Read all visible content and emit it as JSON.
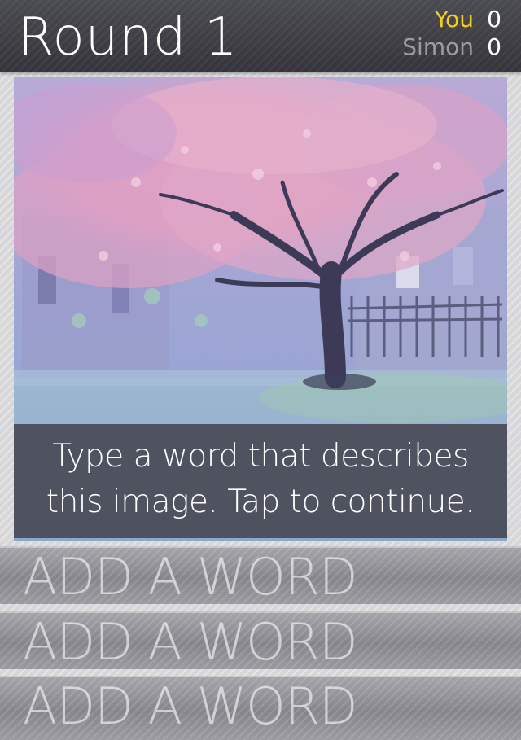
{
  "header": {
    "title": "Round 1"
  },
  "scores": [
    {
      "name": "You",
      "value": "0",
      "color": "#f2cf1f"
    },
    {
      "name": "Simon",
      "value": "0",
      "color": "#9c9ca3"
    }
  ],
  "image": {
    "caption_line1": "Type a word that describes",
    "caption_line2": "this image. Tap to continue."
  },
  "word_slots": [
    {
      "placeholder": "ADD A WORD"
    },
    {
      "placeholder": "ADD A WORD"
    },
    {
      "placeholder": "ADD A WORD"
    }
  ]
}
